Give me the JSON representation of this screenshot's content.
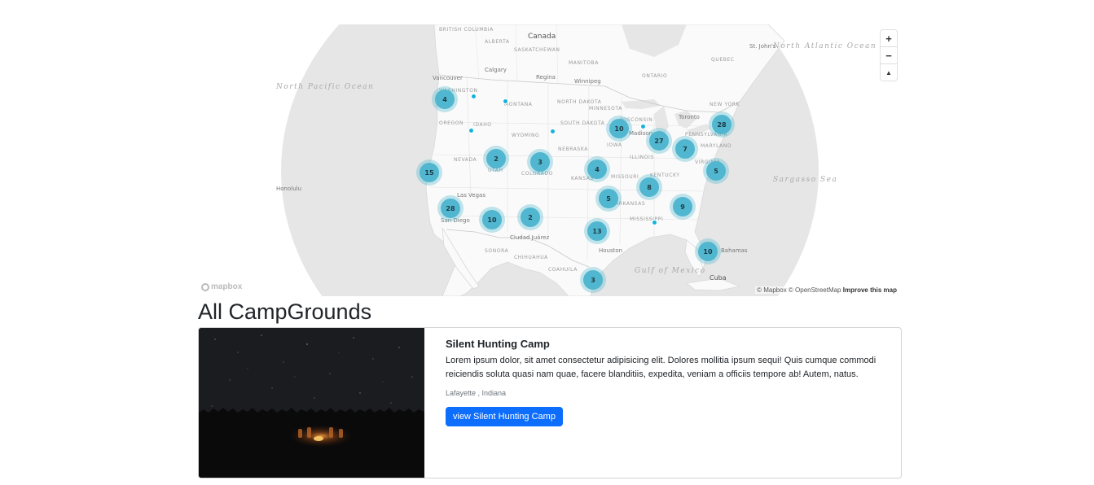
{
  "map": {
    "zoom_in_label": "+",
    "zoom_out_label": "−",
    "compass_label": "▲",
    "logo_text": "mapbox",
    "attribution": "© Mapbox © OpenStreetMap",
    "improve_link": "Improve this map",
    "clusters": [
      "4",
      "2",
      "3",
      "15",
      "28",
      "10",
      "2",
      "4",
      "10",
      "27",
      "7",
      "28",
      "5",
      "8",
      "5",
      "9",
      "13",
      "10",
      "3"
    ],
    "labels": {
      "canada": "Canada",
      "north_pacific": "North Pacific Ocean",
      "north_atlantic": "North Atlantic Ocean",
      "sargasso": "Sargasso Sea",
      "gulf": "Gulf of Mexico",
      "cuba": "Cuba",
      "british_columbia": "British Columbia",
      "alberta": "Alberta",
      "saskatchewan": "Saskatchewan",
      "manitoba": "Manitoba",
      "ontario": "Ontario",
      "quebec": "Quebec",
      "washington": "Washington",
      "oregon": "Oregon",
      "idaho": "Idaho",
      "montana": "Montana",
      "wyoming": "Wyoming",
      "nevada": "Nevada",
      "utah": "Utah",
      "colorado": "Colorado",
      "north_dakota": "North Dakota",
      "south_dakota": "South Dakota",
      "nebraska": "Nebraska",
      "kansas": "Kansas",
      "minnesota": "Minnesota",
      "iowa": "Iowa",
      "missouri": "Missouri",
      "arkansas": "Arkansas",
      "mississippi": "Mississippi",
      "wisconsin": "Wisconsin",
      "illinois": "Illinois",
      "kentucky": "Kentucky",
      "virginia": "Virginia",
      "pennsylvania": "Pennsylvania",
      "maryland": "Maryland",
      "new_york": "New York",
      "sonora": "Sonora",
      "chihuahua": "Chihuahua",
      "coahuila": "Coahuila",
      "calgary": "Calgary",
      "regina": "Regina",
      "winnipeg": "Winnipeg",
      "vancouver": "Vancouver",
      "toronto": "Toronto",
      "madison": "Madison",
      "las_vegas": "Las Vegas",
      "san_diego": "San Diego",
      "ciudad_juarez": "Ciudad Juárez",
      "houston": "Houston",
      "honolulu": "Honolulu",
      "bahamas": "Bahamas",
      "st_johns": "St. John's"
    }
  },
  "page_title": "All CampGrounds",
  "campground": {
    "title": "Silent Hunting Camp",
    "description": "Lorem ipsum dolor, sit amet consectetur adipisicing elit. Dolores mollitia ipsum sequi! Quis cumque commodi reiciendis soluta quasi nam quae, facere blanditiis, expedita, veniam a officiis tempore ab! Autem, natus.",
    "location": "Lafayette , Indiana",
    "button_label": "view Silent Hunting Camp"
  }
}
